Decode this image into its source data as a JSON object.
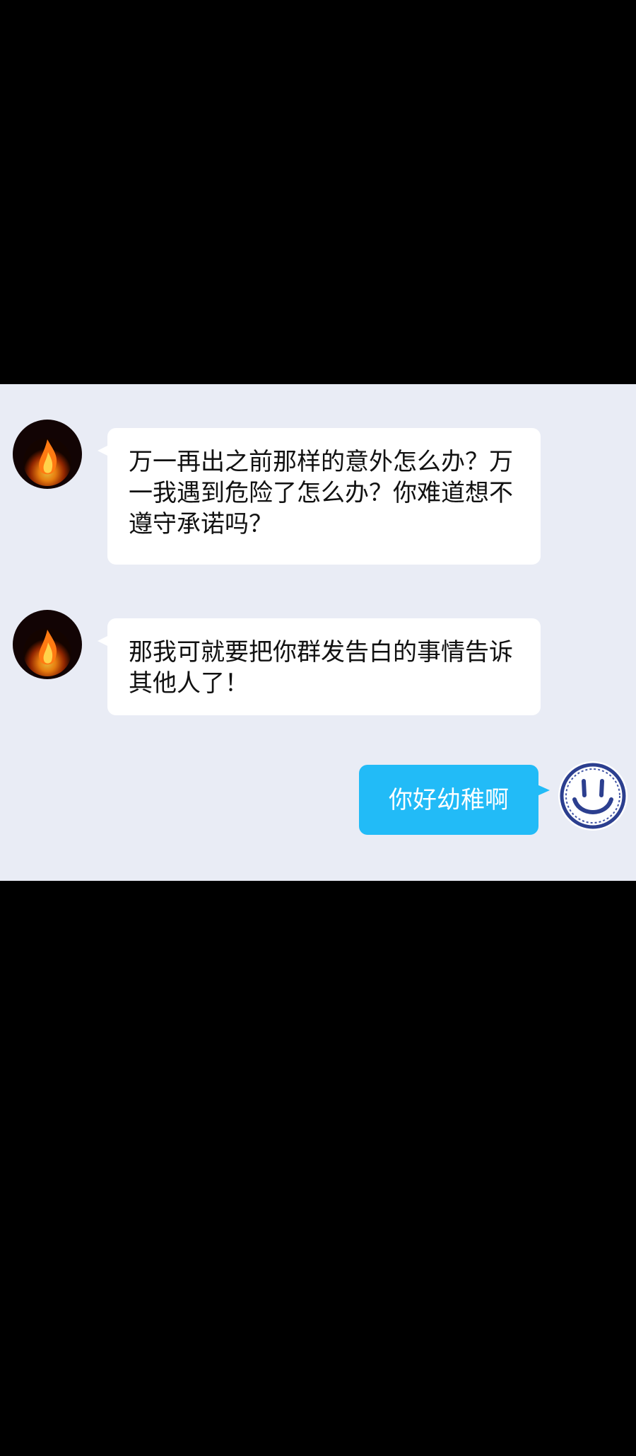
{
  "chat": {
    "messages": [
      {
        "sender": "other",
        "avatar": "flame-avatar",
        "text": "万一再出之前那样的意外怎么办？万一我遇到危险了怎么办？你难道想不遵守承诺吗？"
      },
      {
        "sender": "other",
        "avatar": "flame-avatar",
        "text": "那我可就要把你群发告白的事情告诉其他人了！"
      },
      {
        "sender": "self",
        "avatar": "smiley-avatar",
        "text": "你好幼稚啊"
      }
    ]
  },
  "colors": {
    "chat_background": "#e9ecf5",
    "incoming_bubble": "#ffffff",
    "outgoing_bubble": "#22bbf7",
    "letterbox": "#000000"
  }
}
